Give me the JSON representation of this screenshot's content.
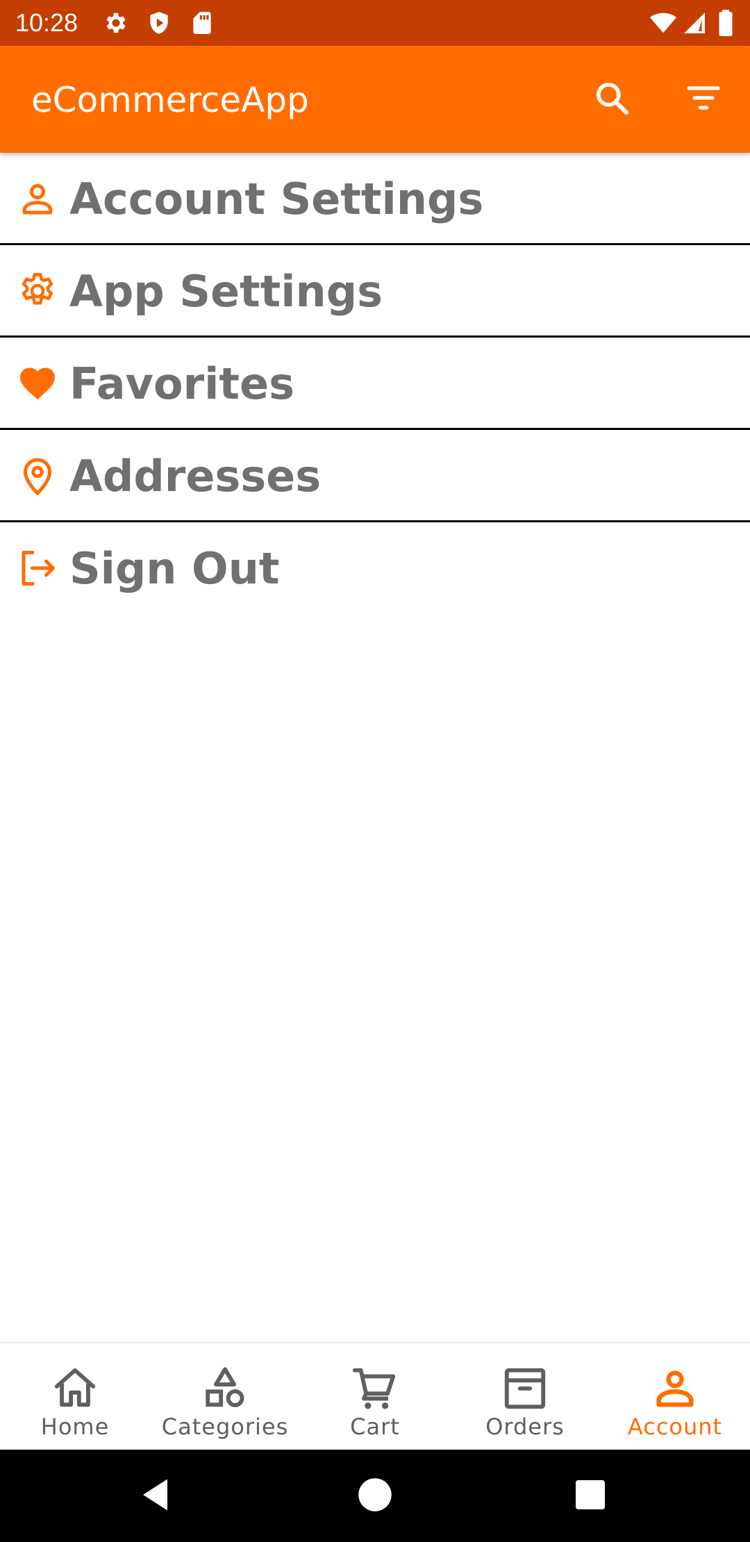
{
  "status_bar": {
    "time": "10:28",
    "icons": [
      "gear-icon",
      "shield-icon",
      "sd-card-icon",
      "wifi-icon",
      "signal-icon",
      "battery-icon"
    ]
  },
  "app_bar": {
    "title": "eCommerceApp",
    "actions": [
      "search-icon",
      "filter-icon"
    ]
  },
  "menu": {
    "items": [
      {
        "label": "Account Settings",
        "icon": "person-icon"
      },
      {
        "label": "App Settings",
        "icon": "gear-icon"
      },
      {
        "label": "Favorites",
        "icon": "heart-icon"
      },
      {
        "label": "Addresses",
        "icon": "location-pin-icon"
      },
      {
        "label": "Sign Out",
        "icon": "logout-icon"
      }
    ]
  },
  "bottom_nav": {
    "items": [
      {
        "label": "Home",
        "icon": "home-icon",
        "active": false
      },
      {
        "label": "Categories",
        "icon": "shapes-icon",
        "active": false
      },
      {
        "label": "Cart",
        "icon": "cart-icon",
        "active": false
      },
      {
        "label": "Orders",
        "icon": "archive-box-icon",
        "active": false
      },
      {
        "label": "Account",
        "icon": "person-icon",
        "active": true
      }
    ]
  },
  "system_nav": [
    "back-icon",
    "home-circle-icon",
    "recents-icon"
  ],
  "colors": {
    "status_bar": "#C43E00",
    "primary": "#FF6D00",
    "menu_text": "#707070",
    "nav_inactive": "#5f5f5f"
  }
}
